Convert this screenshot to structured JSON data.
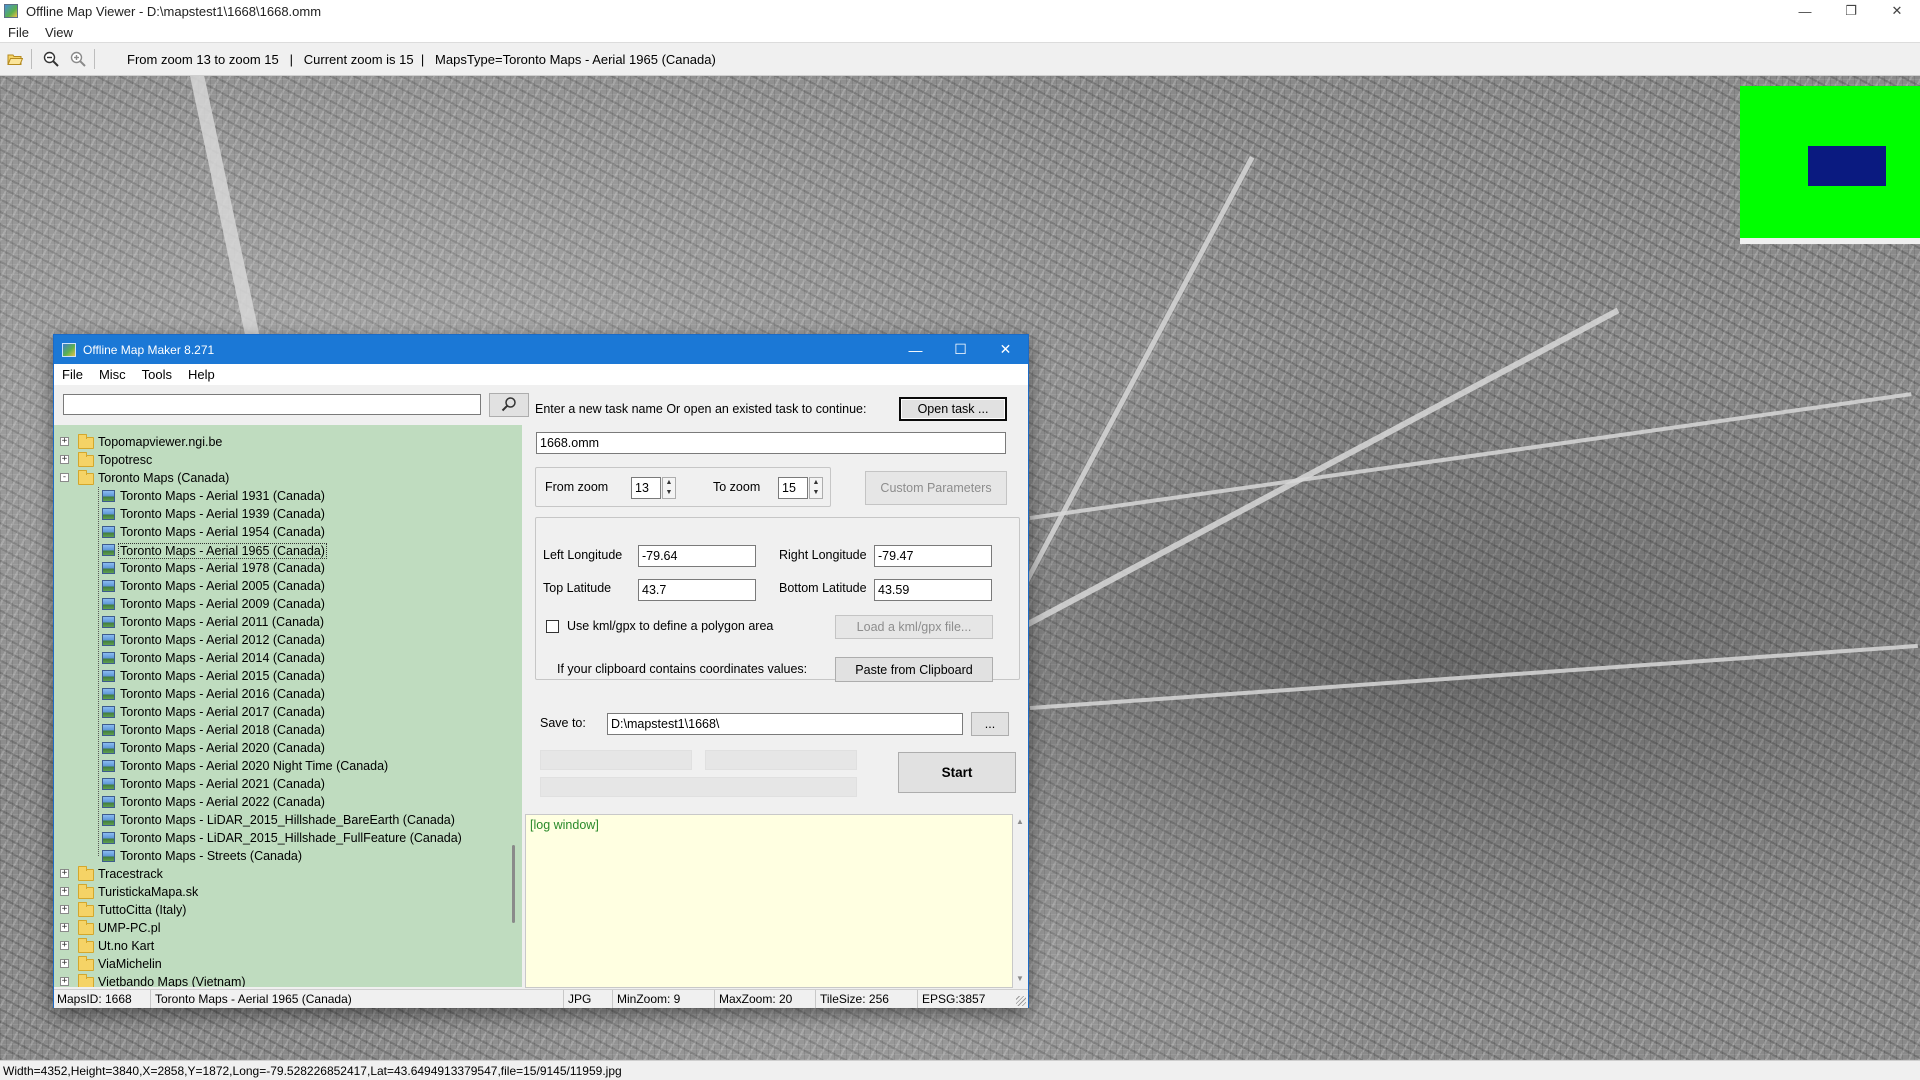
{
  "outer_window": {
    "title": "Offline Map Viewer - D:\\mapstest1\\1668\\1668.omm",
    "menu": [
      "File",
      "View"
    ],
    "toolbar_icons": [
      "open-folder-icon",
      "zoom-out-icon",
      "zoom-in-icon"
    ],
    "toolbar_status": "From zoom 13 to zoom 15   |   Current zoom is 15  |   MapsType=Toronto Maps - Aerial 1965 (Canada)",
    "statusbar": "Width=4352,Height=3840,X=2858,Y=1872,Long=-79.528226852417,Lat=43.6494913379547,file=15/9145/11959.jpg",
    "minimap_color": "#00ff00",
    "minimap_view_color": "#0a1a80"
  },
  "dialog": {
    "title": "Offline Map Maker 8.271",
    "menu": [
      "File",
      "Misc",
      "Tools",
      "Help"
    ],
    "search": {
      "value": "",
      "placeholder": ""
    },
    "tree": [
      {
        "label": "Topomapviewer.ngi.be",
        "level": 0,
        "type": "folder",
        "expander": "+"
      },
      {
        "label": "Topotresc",
        "level": 0,
        "type": "folder",
        "expander": "+"
      },
      {
        "label": "Toronto Maps (Canada)",
        "level": 0,
        "type": "folder-open",
        "expander": "-"
      },
      {
        "label": "Toronto Maps - Aerial 1931 (Canada)",
        "level": 1,
        "type": "map"
      },
      {
        "label": "Toronto Maps - Aerial 1939 (Canada)",
        "level": 1,
        "type": "map"
      },
      {
        "label": "Toronto Maps - Aerial 1954 (Canada)",
        "level": 1,
        "type": "map"
      },
      {
        "label": "Toronto Maps - Aerial 1965 (Canada)",
        "level": 1,
        "type": "map",
        "selected": true
      },
      {
        "label": "Toronto Maps - Aerial 1978 (Canada)",
        "level": 1,
        "type": "map"
      },
      {
        "label": "Toronto Maps - Aerial 2005 (Canada)",
        "level": 1,
        "type": "map"
      },
      {
        "label": "Toronto Maps - Aerial 2009 (Canada)",
        "level": 1,
        "type": "map"
      },
      {
        "label": "Toronto Maps - Aerial 2011 (Canada)",
        "level": 1,
        "type": "map"
      },
      {
        "label": "Toronto Maps - Aerial 2012 (Canada)",
        "level": 1,
        "type": "map"
      },
      {
        "label": "Toronto Maps - Aerial 2014 (Canada)",
        "level": 1,
        "type": "map"
      },
      {
        "label": "Toronto Maps - Aerial 2015 (Canada)",
        "level": 1,
        "type": "map"
      },
      {
        "label": "Toronto Maps - Aerial 2016 (Canada)",
        "level": 1,
        "type": "map"
      },
      {
        "label": "Toronto Maps - Aerial 2017 (Canada)",
        "level": 1,
        "type": "map"
      },
      {
        "label": "Toronto Maps - Aerial 2018 (Canada)",
        "level": 1,
        "type": "map"
      },
      {
        "label": "Toronto Maps - Aerial 2020 (Canada)",
        "level": 1,
        "type": "map"
      },
      {
        "label": "Toronto Maps - Aerial 2020 Night Time (Canada)",
        "level": 1,
        "type": "map"
      },
      {
        "label": "Toronto Maps - Aerial 2021 (Canada)",
        "level": 1,
        "type": "map"
      },
      {
        "label": "Toronto Maps - Aerial 2022 (Canada)",
        "level": 1,
        "type": "map"
      },
      {
        "label": "Toronto Maps - LiDAR_2015_Hillshade_BareEarth (Canada)",
        "level": 1,
        "type": "map"
      },
      {
        "label": "Toronto Maps - LiDAR_2015_Hillshade_FullFeature (Canada)",
        "level": 1,
        "type": "map"
      },
      {
        "label": "Toronto Maps - Streets (Canada)",
        "level": 1,
        "type": "map"
      },
      {
        "label": "Tracestrack",
        "level": 0,
        "type": "folder",
        "expander": "+"
      },
      {
        "label": "TuristickaMapa.sk",
        "level": 0,
        "type": "folder",
        "expander": "+"
      },
      {
        "label": "TuttoCitta (Italy)",
        "level": 0,
        "type": "folder",
        "expander": "+"
      },
      {
        "label": "UMP-PC.pl",
        "level": 0,
        "type": "folder",
        "expander": "+"
      },
      {
        "label": "Ut.no Kart",
        "level": 0,
        "type": "folder",
        "expander": "+"
      },
      {
        "label": "ViaMichelin",
        "level": 0,
        "type": "folder",
        "expander": "+"
      },
      {
        "label": "Vietbando Maps (Vietnam)",
        "level": 0,
        "type": "folder",
        "expander": "+"
      }
    ],
    "form": {
      "task_prompt": "Enter a new task name Or open an existed task to continue:",
      "open_task_button": "Open task ...",
      "task_name_value": "1668.omm",
      "from_zoom_label": "From zoom",
      "from_zoom_value": "13",
      "to_zoom_label": "To zoom",
      "to_zoom_value": "15",
      "custom_parameters_button": "Custom Parameters",
      "left_longitude_label": "Left Longitude",
      "left_longitude_value": "-79.64",
      "right_longitude_label": "Right Longitude",
      "right_longitude_value": "-79.47",
      "top_latitude_label": "Top Latitude",
      "top_latitude_value": "43.7",
      "bottom_latitude_label": "Bottom Latitude",
      "bottom_latitude_value": "43.59",
      "kml_checkbox_label": "Use kml/gpx to define a polygon area",
      "kml_checked": false,
      "load_kml_button": "Load a kml/gpx file...",
      "clipboard_prompt": "If your clipboard contains coordinates values:",
      "paste_clipboard_button": "Paste from Clipboard",
      "save_to_label": "Save to:",
      "save_to_value": "D:\\mapstest1\\1668\\",
      "browse_button": "...",
      "start_button": "Start",
      "log_text": "[log window]"
    },
    "statusbar": {
      "maps_id": "MapsID: 1668",
      "map_name": "Toronto Maps - Aerial 1965 (Canada)",
      "format": "JPG",
      "min_zoom": "MinZoom: 9",
      "max_zoom": "MaxZoom: 20",
      "tile_size": "TileSize: 256",
      "epsg": "EPSG:3857"
    }
  }
}
